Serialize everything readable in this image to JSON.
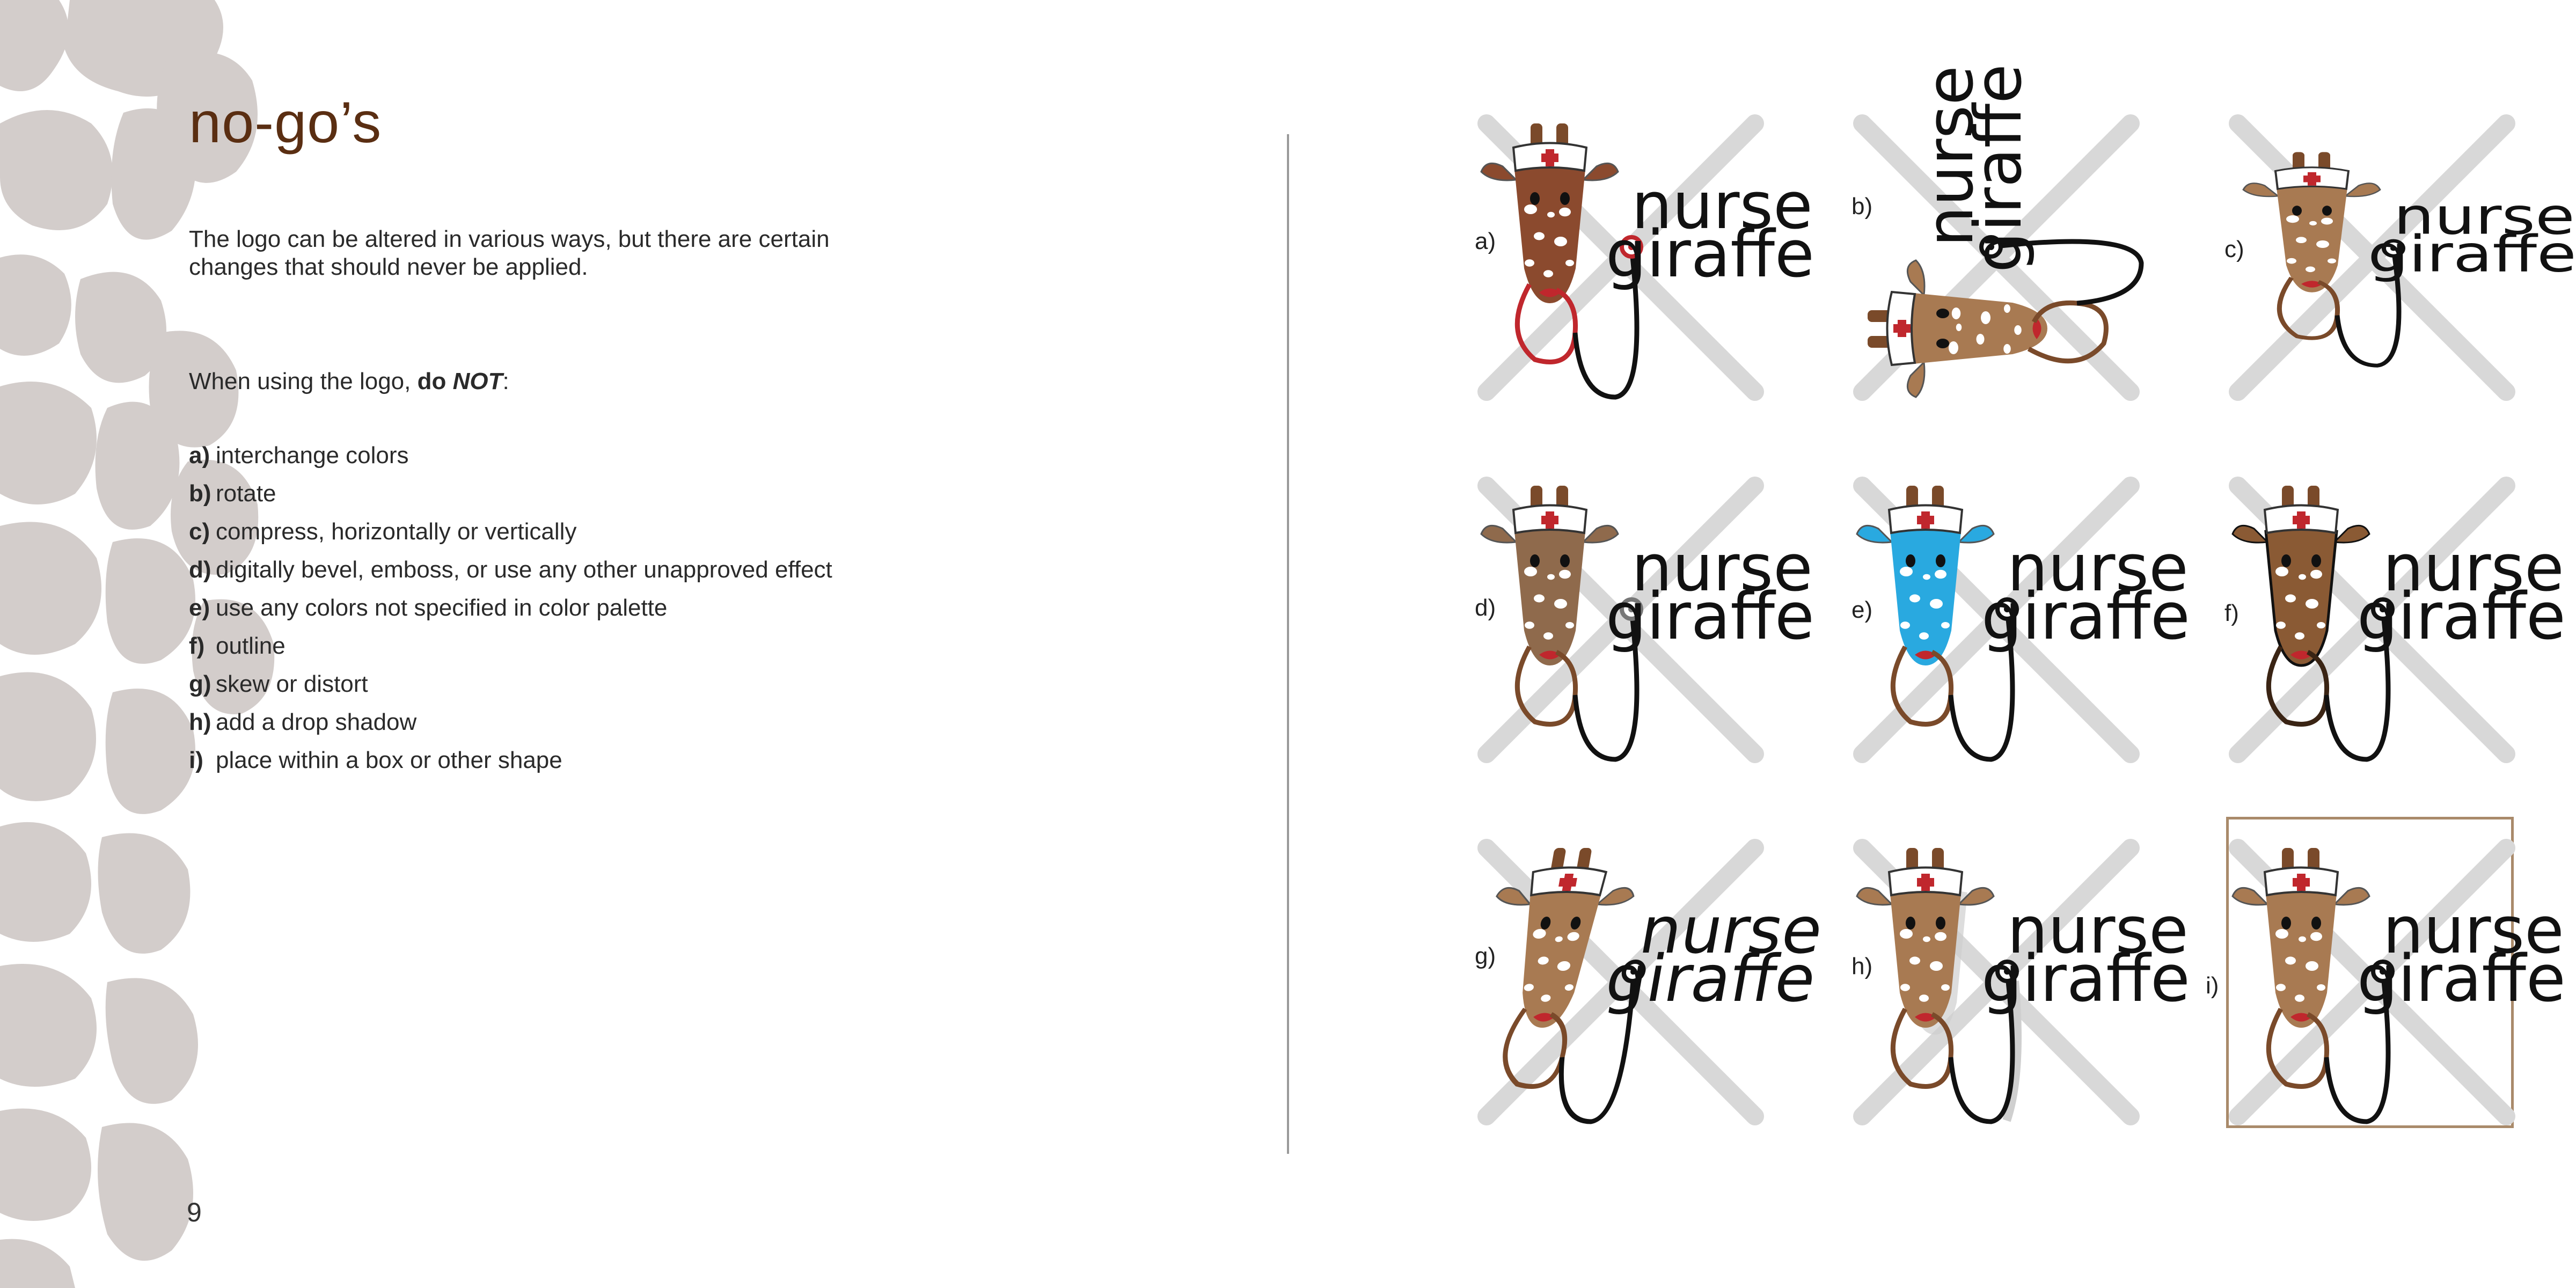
{
  "header": {
    "title": "no-go’s"
  },
  "intro": "The logo can be altered in various ways, but there are certain changes that should never be applied.",
  "lead": {
    "prefix": "When using the logo, ",
    "do": "do",
    "not": "NOT",
    "suffix": ":"
  },
  "rules": [
    {
      "letter": "a)",
      "text": "interchange colors"
    },
    {
      "letter": "b)",
      "text": "rotate"
    },
    {
      "letter": "c)",
      "text": "compress, horizontally or vertically"
    },
    {
      "letter": "d)",
      "text": "digitally bevel, emboss, or use any other unapproved effect"
    },
    {
      "letter": "e)",
      "text": "use any colors not specified in color palette"
    },
    {
      "letter": "f)",
      "text": "outline"
    },
    {
      "letter": "g)",
      "text": "skew or distort"
    },
    {
      "letter": "h)",
      "text": "add a drop shadow"
    },
    {
      "letter": "i)",
      "text": "place within a box or other shape"
    }
  ],
  "page_number": "9",
  "logo": {
    "word1": "nurse",
    "word2": "giraffe"
  },
  "examples": [
    {
      "label": "a)",
      "variant": "interchange-colors"
    },
    {
      "label": "b)",
      "variant": "rotate"
    },
    {
      "label": "c)",
      "variant": "compress"
    },
    {
      "label": "d)",
      "variant": "bevel"
    },
    {
      "label": "e)",
      "variant": "off-palette"
    },
    {
      "label": "f)",
      "variant": "outline"
    },
    {
      "label": "g)",
      "variant": "skew"
    },
    {
      "label": "h)",
      "variant": "drop-shadow"
    },
    {
      "label": "i)",
      "variant": "boxed"
    }
  ],
  "colors": {
    "title": "#5a2e12",
    "pattern_spot": "#d3cdcb",
    "giraffe_brown": "#a87a52",
    "hat_cross": "#c0272d",
    "cross_mark": "#d8d8d8",
    "off_palette_blue": "#29a9e0",
    "box_border": "#a98a6a"
  },
  "icons": [
    "giraffe-head-icon",
    "nurse-cap-icon",
    "stethoscope-icon",
    "cross-out-icon"
  ]
}
